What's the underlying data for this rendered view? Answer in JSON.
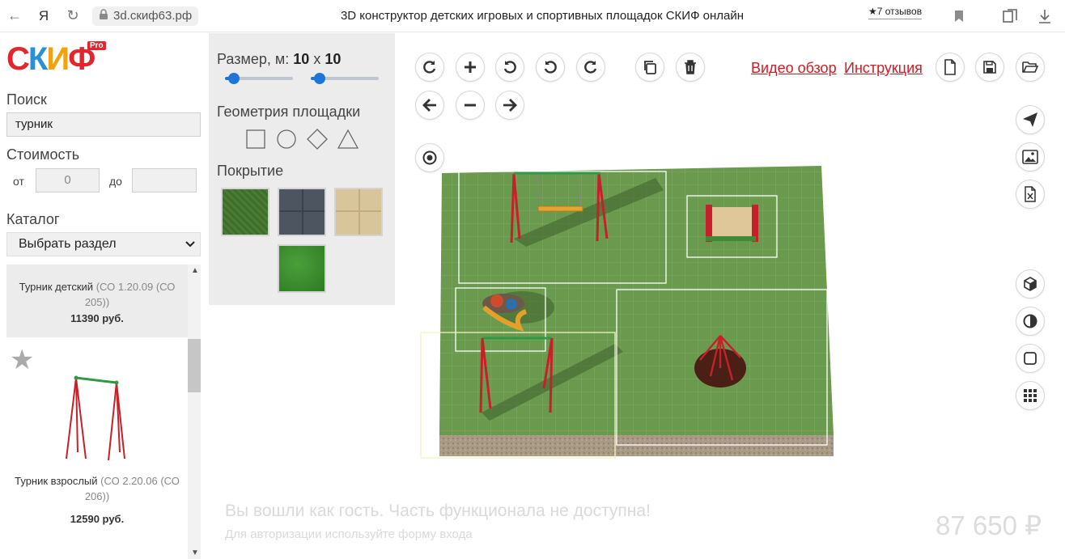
{
  "browser": {
    "back_glyph": "←",
    "yandex_glyph": "Я",
    "reload_glyph": "↻",
    "url": "3d.скиф63.рф",
    "title": "3D конструктор детских игровых и спортивных площадок СКИФ онлайн",
    "reviews": "★7 отзывов",
    "icons": [
      "back-icon",
      "yandex-icon",
      "reload-icon",
      "lock-icon",
      "bookmark-icon",
      "collections-icon",
      "download-icon"
    ]
  },
  "logo": {
    "part1": "С",
    "part2": "К",
    "part3": "И",
    "part4": "Ф",
    "badge": "Pro"
  },
  "sidebar": {
    "search_label": "Поиск",
    "search_value": "турник",
    "cost_label": "Стоимость",
    "from_label": "от",
    "from_value": "0",
    "to_label": "до",
    "to_value": "",
    "catalog_label": "Каталог",
    "catalog_select": "Выбрать раздел",
    "items": [
      {
        "name": "Турник детский",
        "code": "(СО 1.20.09 (СО 205))",
        "price": "11390 руб."
      },
      {
        "name": "Турник взрослый",
        "code": "(СО 2.20.06 (СО 206))",
        "price": "12590 руб."
      }
    ]
  },
  "settings": {
    "size_label": "Размер, м:",
    "size_w": "10",
    "size_x": "x",
    "size_h": "10",
    "geometry_label": "Геометрия площадки",
    "cover_label": "Покрытие",
    "slider_w_fraction": 0.1,
    "slider_h_fraction": 0.1,
    "covers": [
      "grass",
      "gray-tiles",
      "sand-tiles",
      "artificial-turf"
    ]
  },
  "toolbar": {
    "video": "Видео обзор",
    "instruction": "Инструкция",
    "icons": [
      "rotate-right-icon",
      "add-icon",
      "undo-icon",
      "rotate-left-icon",
      "redo-icon",
      "copy-icon",
      "trash-icon",
      "arrow-left-icon",
      "minus-icon",
      "arrow-right-icon",
      "target-icon",
      "new-file-icon",
      "save-icon",
      "open-folder-icon",
      "send-icon",
      "image-icon",
      "excel-icon",
      "cube-icon",
      "contrast-icon",
      "square-icon",
      "grid-icon"
    ]
  },
  "footer": {
    "guest_line1": "Вы вошли как гость. Часть функционала не доступна!",
    "guest_line2": "Для авторизации используйте форму входа",
    "total": "87 650 ₽"
  },
  "colors": {
    "brand_red": "#e3262e",
    "link_red": "#d71920",
    "slider_blue": "#1e74d8",
    "ground_green": "#6a9a4e"
  }
}
